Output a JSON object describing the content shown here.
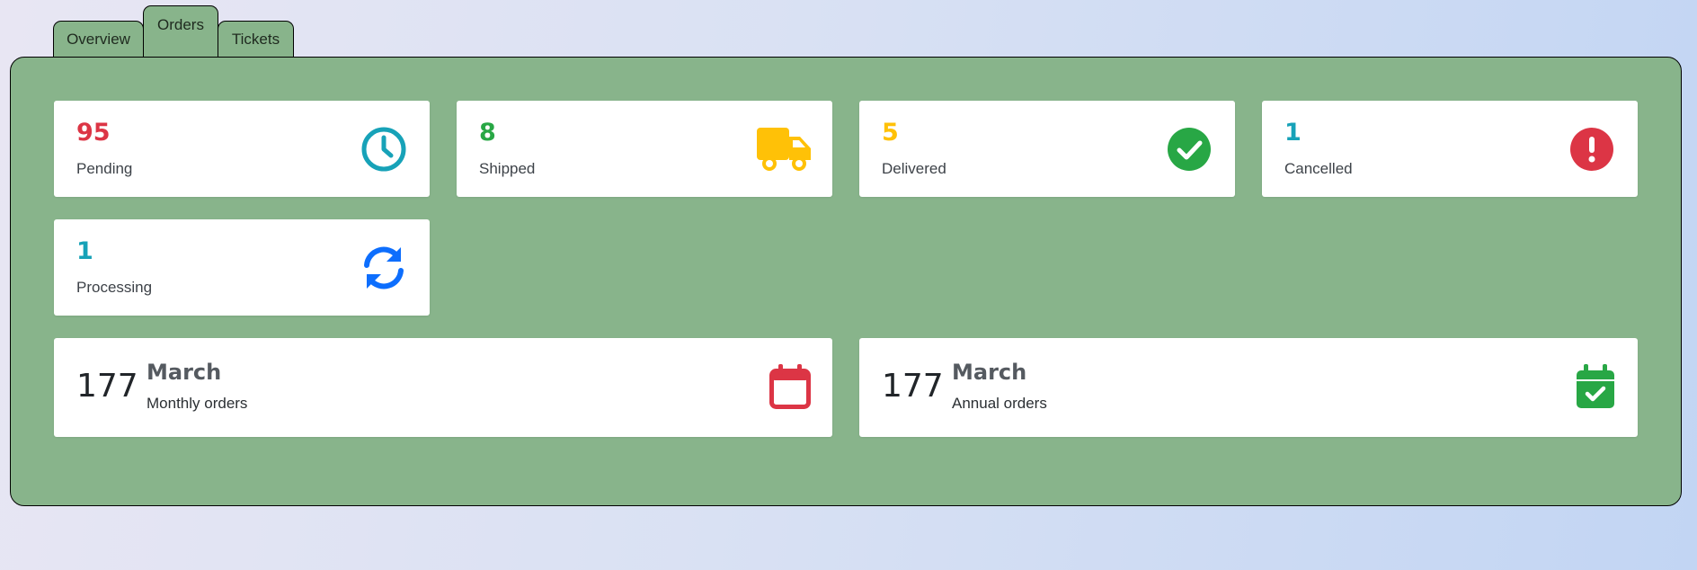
{
  "tabs": {
    "overview": "Overview",
    "orders": "Orders",
    "tickets": "Tickets",
    "active": "Orders"
  },
  "colors": {
    "panel_bg": "#88b48b",
    "red": "#dc3545",
    "green": "#28a745",
    "yellow": "#ffc107",
    "teal": "#17a2b8",
    "blue": "#0d6efd"
  },
  "stats": {
    "pending": {
      "value": "95",
      "label": "Pending",
      "icon": "clock-icon"
    },
    "shipped": {
      "value": "8",
      "label": "Shipped",
      "icon": "truck-icon"
    },
    "delivered": {
      "value": "5",
      "label": "Delivered",
      "icon": "check-circle-icon"
    },
    "cancelled": {
      "value": "1",
      "label": "Cancelled",
      "icon": "exclamation-circle-icon"
    },
    "processing": {
      "value": "1",
      "label": "Processing",
      "icon": "sync-icon"
    }
  },
  "summary": {
    "monthly": {
      "value": "177",
      "month": "March",
      "label": "Monthly orders",
      "icon": "calendar-icon"
    },
    "annual": {
      "value": "177",
      "month": "March",
      "label": "Annual orders",
      "icon": "calendar-check-icon"
    }
  }
}
